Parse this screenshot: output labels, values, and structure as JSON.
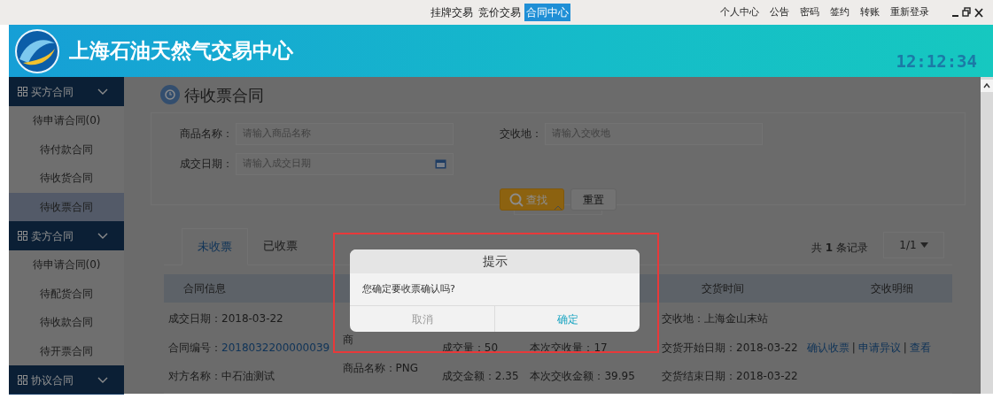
{
  "top_nav": {
    "center_links": [
      {
        "label": "挂牌交易",
        "selected": false
      },
      {
        "label": "竞价交易",
        "selected": false
      },
      {
        "label": "合同中心",
        "selected": true
      }
    ],
    "right_links": [
      "个人中心",
      "公告",
      "密码",
      "签约",
      "转账",
      "重新登录"
    ]
  },
  "header": {
    "title": "上海石油天然气交易中心",
    "clock": "12:12:34"
  },
  "sidebar": {
    "groups": [
      {
        "label": "买方合同",
        "expanded": true,
        "items": [
          {
            "label": "待申请合同(0)",
            "selected": false
          },
          {
            "label": "待付款合同",
            "selected": false
          },
          {
            "label": "待收货合同",
            "selected": false
          },
          {
            "label": "待收票合同",
            "selected": true
          }
        ]
      },
      {
        "label": "卖方合同",
        "expanded": true,
        "items": [
          {
            "label": "待申请合同(0)",
            "selected": false
          },
          {
            "label": "待配货合同",
            "selected": false
          },
          {
            "label": "待收款合同",
            "selected": false
          },
          {
            "label": "待开票合同",
            "selected": false
          }
        ]
      },
      {
        "label": "协议合同",
        "expanded": true
      }
    ]
  },
  "page": {
    "title": "待收票合同"
  },
  "filters": [
    {
      "label": "商品名称：",
      "placeholder": "请输入商品名称",
      "kind": "text"
    },
    {
      "label": "交收地：",
      "placeholder": "请输入交收地",
      "kind": "text"
    },
    {
      "label": "成交日期：",
      "placeholder": "请输入成交日期",
      "kind": "date"
    }
  ],
  "buttons": [
    {
      "label": "查找",
      "kind": "primary"
    },
    {
      "label": "重置",
      "kind": "secondary"
    }
  ],
  "tabs": [
    {
      "label": "未收票",
      "selected": true
    },
    {
      "label": "已收票",
      "selected": false
    }
  ],
  "records": "共 **1** 条记录",
  "pager": "1/1",
  "table": {
    "columns": [
      "合同信息",
      null,
      null,
      null,
      "交货时间",
      "交收明细"
    ],
    "rows": [
      {
        "cells": [
          [
            {
              "kind": "text",
              "text": "成交日期：2018-03-22"
            },
            {
              "kind": "link",
              "label": "合同编号：",
              "link": "2018032200000039"
            },
            {
              "kind": "text",
              "text": "对方名称：中石油测试"
            }
          ],
          [
            {
              "kind": "text",
              "text": "商"
            },
            {
              "kind": "text",
              "text": "商品名称：PNG"
            }
          ],
          [
            {
              "kind": "hidden"
            },
            {
              "kind": "text",
              "text": "成交量：50"
            },
            {
              "kind": "text",
              "text": "成交金额：2.35"
            }
          ],
          [
            {
              "kind": "hidden"
            },
            {
              "kind": "text",
              "text": "本次交收量：17"
            },
            {
              "kind": "text",
              "text": "本次交收金额：39.95"
            }
          ],
          [
            {
              "kind": "text",
              "text": "交收地：上海金山末站"
            },
            {
              "kind": "text",
              "text": "交货开始日期：2018-03-22"
            },
            {
              "kind": "text",
              "text": "交货结束日期：2018-03-22"
            }
          ],
          [
            {
              "kind": "actions",
              "actions": [
                "确认收票",
                "申请异议",
                "查看"
              ],
              "separators": [
                "|",
                "|"
              ]
            }
          ]
        ]
      }
    ]
  },
  "dialog": {
    "title": "提示",
    "message": "您确定要收票确认吗?",
    "buttons": [
      {
        "label": "取消",
        "kind": "cancel"
      },
      {
        "label": "确定",
        "kind": "confirm"
      }
    ]
  }
}
